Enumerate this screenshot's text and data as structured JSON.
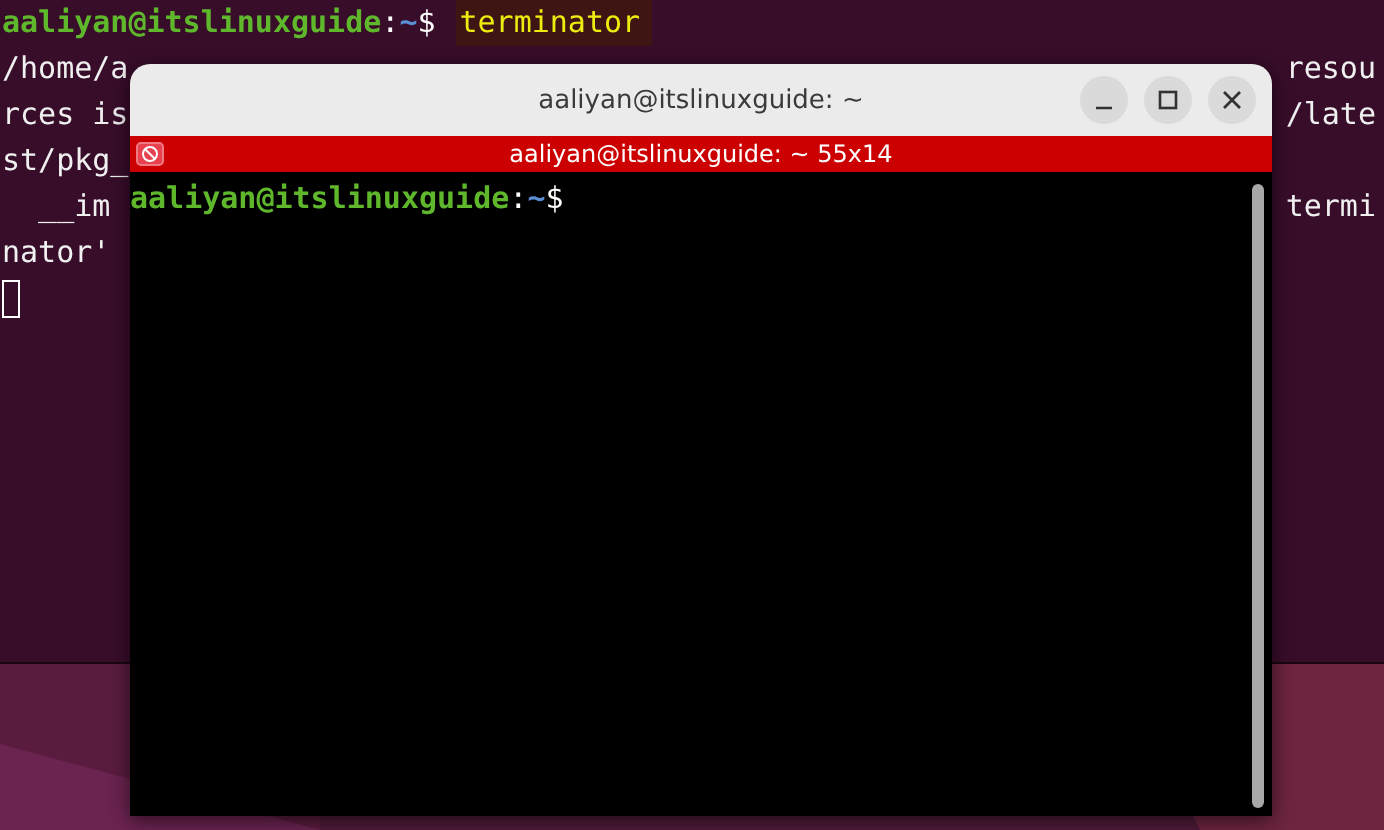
{
  "background_terminal": {
    "lines": [
      {
        "kind": "prompt",
        "user_host": "aaliyan@itslinuxguide",
        "separator": ":",
        "path": "~",
        "symbol": "$",
        "command": "terminator"
      },
      {
        "kind": "output",
        "left": "/home/a",
        "right": "resou"
      },
      {
        "kind": "output",
        "left": "rces is",
        "right": "/late"
      },
      {
        "kind": "output",
        "left": "st/pkg_"
      },
      {
        "kind": "output",
        "left": "  __im",
        "right": "termi"
      },
      {
        "kind": "output",
        "left": "nator'"
      },
      {
        "kind": "cursor"
      }
    ]
  },
  "window": {
    "title": "aaliyan@itslinuxguide: ~",
    "terminal": {
      "title": "aaliyan@itslinuxguide: ~ 55x14",
      "lines": [
        {
          "kind": "prompt",
          "user_host": "aaliyan@itslinuxguide",
          "separator": ":",
          "path": "~",
          "symbol": "$"
        }
      ]
    }
  }
}
